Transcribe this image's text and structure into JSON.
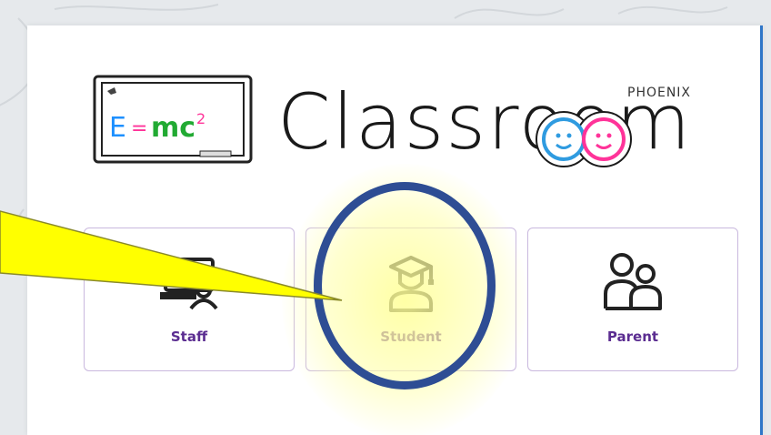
{
  "brand": {
    "sub": "PHOENIX",
    "title": "Classroom"
  },
  "logo": {
    "formula": "E=mc²"
  },
  "tiles": [
    {
      "label": "Staff",
      "icon": "staff-icon"
    },
    {
      "label": "Student",
      "icon": "student-icon"
    },
    {
      "label": "Parent",
      "icon": "parent-icon"
    }
  ],
  "colors": {
    "accent": "#5b2d91",
    "tile_border": "#c9b8de",
    "ring": "#2e4d94",
    "callout": "#ffff00",
    "card_edge": "#2f76c8"
  }
}
